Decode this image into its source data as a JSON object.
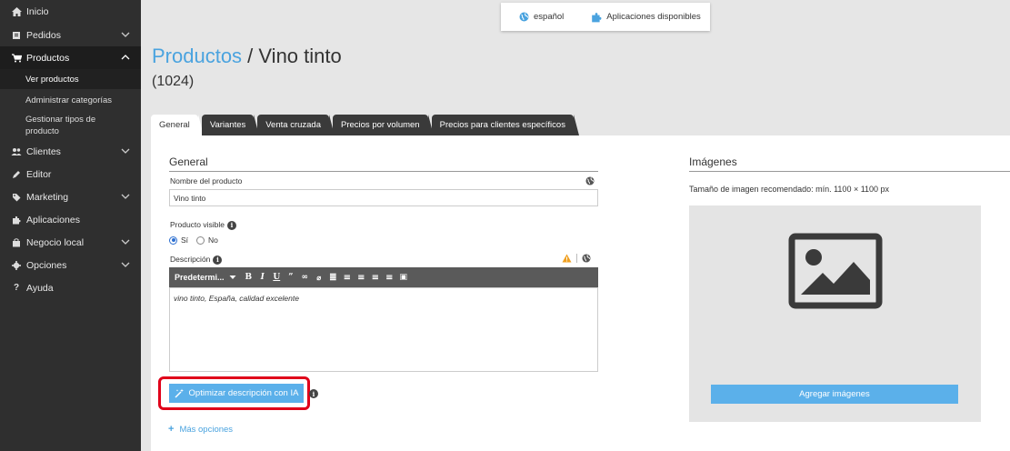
{
  "sidebar": {
    "items": [
      {
        "label": "Inicio",
        "icon": "home-icon",
        "chevron": false
      },
      {
        "label": "Pedidos",
        "icon": "orders-icon",
        "chevron": "down"
      },
      {
        "label": "Productos",
        "icon": "cart-icon",
        "chevron": "up",
        "active": true
      },
      {
        "label": "Clientes",
        "icon": "users-icon",
        "chevron": "down"
      },
      {
        "label": "Editor",
        "icon": "pencil-icon",
        "chevron": false
      },
      {
        "label": "Marketing",
        "icon": "tag-icon",
        "chevron": "down"
      },
      {
        "label": "Aplicaciones",
        "icon": "puzzle-icon",
        "chevron": false
      },
      {
        "label": "Negocio local",
        "icon": "store-icon",
        "chevron": "down"
      },
      {
        "label": "Opciones",
        "icon": "gear-icon",
        "chevron": "down"
      },
      {
        "label": "Ayuda",
        "icon": "help-icon",
        "chevron": false
      }
    ],
    "sub_items": [
      "Ver productos",
      "Administrar categorías",
      "Gestionar tipos de producto"
    ]
  },
  "topbar": {
    "language": "español",
    "apps": "Aplicaciones disponibles"
  },
  "header": {
    "breadcrumb": "Productos",
    "separator": " / ",
    "product_name": "Vino tinto",
    "product_id": "(1024)"
  },
  "tabs": [
    "General",
    "Variantes",
    "Venta cruzada",
    "Precios por volumen",
    "Precios para clientes específicos"
  ],
  "general": {
    "section_title": "General",
    "name_label": "Nombre del producto",
    "name_value": "Vino tinto",
    "visible_label": "Producto visible",
    "visible_yes": "Sí",
    "visible_no": "No",
    "visible_selected": "Sí",
    "description_label": "Descripción",
    "format_select": "Predetermi...",
    "description_text": "vino tinto, España, calidad excelente",
    "ai_button": "Optimizar descripción con IA",
    "more_options": "Más opciones"
  },
  "images": {
    "section_title": "Imágenes",
    "recommended": "Tamaño de imagen recomendado: mín. 1100 × 1100 px",
    "add_button": "Agregar imágenes"
  },
  "colors": {
    "accent": "#4aa3df",
    "button": "#5bb0ea",
    "highlight": "#e0001a",
    "sidebar": "#2f2f2f"
  }
}
